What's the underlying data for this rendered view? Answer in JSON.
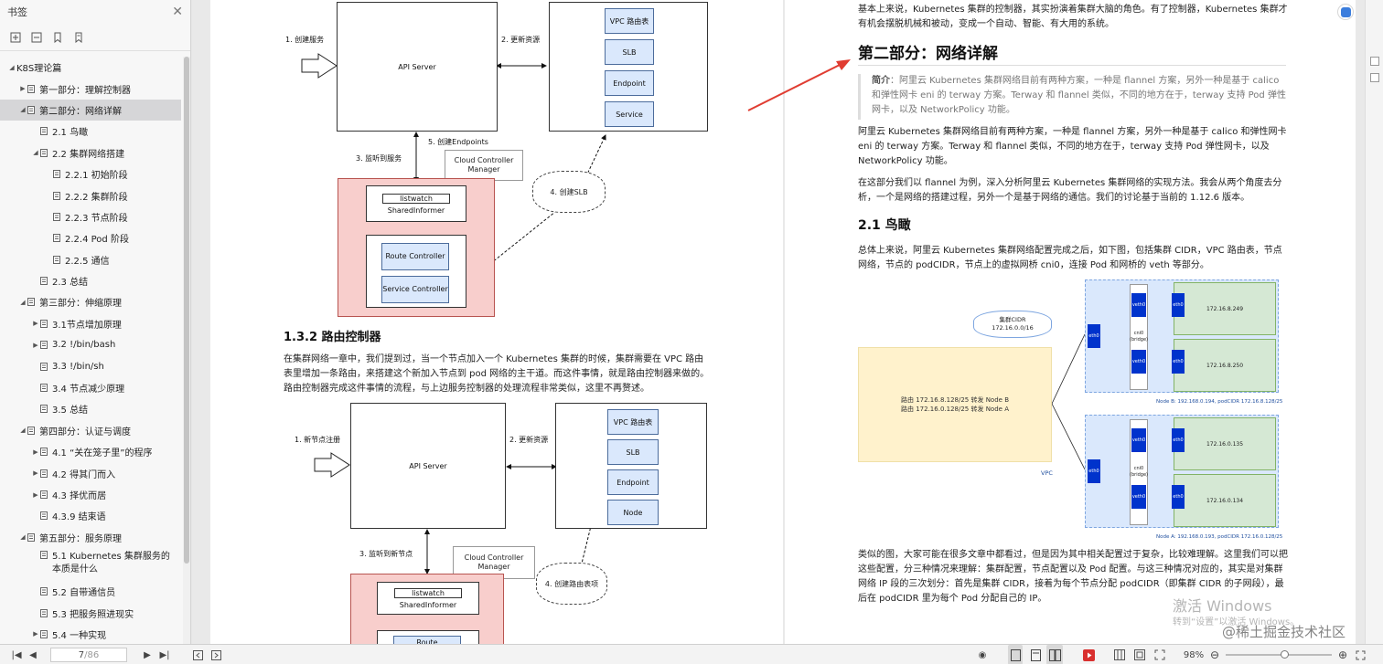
{
  "sidebar": {
    "title": "书签",
    "items": [
      {
        "label": "K8S理论篇",
        "level": 0,
        "expand": "▲",
        "bookmark": false
      },
      {
        "label": "第一部分：理解控制器",
        "level": 1,
        "expand": "▶",
        "bookmark": true
      },
      {
        "label": "第二部分：网络详解",
        "level": 1,
        "expand": "▲",
        "bookmark": true,
        "selected": true
      },
      {
        "label": "2.1 鸟瞰",
        "level": 2,
        "expand": "",
        "bookmark": true
      },
      {
        "label": "2.2 集群网络搭建",
        "level": 2,
        "expand": "▲",
        "bookmark": true
      },
      {
        "label": "2.2.1 初始阶段",
        "level": 3,
        "expand": "",
        "bookmark": true
      },
      {
        "label": "2.2.2 集群阶段",
        "level": 3,
        "expand": "",
        "bookmark": true
      },
      {
        "label": "2.2.3 节点阶段",
        "level": 3,
        "expand": "",
        "bookmark": true
      },
      {
        "label": "2.2.4 Pod 阶段",
        "level": 3,
        "expand": "",
        "bookmark": true
      },
      {
        "label": "2.2.5 通信",
        "level": 3,
        "expand": "",
        "bookmark": true
      },
      {
        "label": "2.3 总结",
        "level": 2,
        "expand": "",
        "bookmark": true
      },
      {
        "label": "第三部分：伸缩原理",
        "level": 1,
        "expand": "▲",
        "bookmark": true
      },
      {
        "label": "3.1节点增加原理",
        "level": 2,
        "expand": "▶",
        "bookmark": true
      },
      {
        "label": "3.2 !/bin/bash",
        "level": 2,
        "expand": "▶",
        "bookmark": true
      },
      {
        "label": "3.3 !/bin/sh",
        "level": 2,
        "expand": "",
        "bookmark": true
      },
      {
        "label": "3.4 节点减少原理",
        "level": 2,
        "expand": "",
        "bookmark": true
      },
      {
        "label": "3.5 总结",
        "level": 2,
        "expand": "",
        "bookmark": true
      },
      {
        "label": "第四部分：认证与调度",
        "level": 1,
        "expand": "▲",
        "bookmark": true
      },
      {
        "label": "4.1 “关在笼子里”的程序",
        "level": 2,
        "expand": "▶",
        "bookmark": true
      },
      {
        "label": "4.2 得其门而入",
        "level": 2,
        "expand": "▶",
        "bookmark": true
      },
      {
        "label": "4.3 择优而居",
        "level": 2,
        "expand": "▶",
        "bookmark": true
      },
      {
        "label": "4.3.9 结束语",
        "level": 2,
        "expand": "",
        "bookmark": true
      },
      {
        "label": "第五部分：服务原理",
        "level": 1,
        "expand": "▲",
        "bookmark": true
      },
      {
        "label": "5.1 Kubernetes 集群服务的本质是什么",
        "level": 2,
        "expand": "",
        "bookmark": true,
        "tall": true
      },
      {
        "label": "5.2 自带通信员",
        "level": 2,
        "expand": "",
        "bookmark": true
      },
      {
        "label": "5.3 把服务照进现实",
        "level": 2,
        "expand": "",
        "bookmark": true
      },
      {
        "label": "5.4 一种实现",
        "level": 2,
        "expand": "▶",
        "bookmark": true
      }
    ]
  },
  "left_page": {
    "diagram1": {
      "step1": "1. 创建服务",
      "api_server": "API Server",
      "step2": "2. 更新资源",
      "resources": [
        "VPC 路由表",
        "SLB",
        "Endpoint",
        "Service"
      ],
      "step3": "3. 监听到服务",
      "step5": "5. 创建Endpoints",
      "ccm": "Cloud Controller Manager",
      "step4": "4. 创建SLB",
      "listwatch": "listwatch",
      "informer": "SharedInformer",
      "ctrl1": "Route Controller",
      "ctrl2": "Service Controller"
    },
    "heading": "1.3.2 路由控制器",
    "paragraph": "在集群网络一章中，我们提到过，当一个节点加入一个 Kubernetes 集群的时候，集群需要在 VPC 路由表里增加一条路由，来搭建这个新加入节点到 pod 网络的主干道。而这件事情，就是路由控制器来做的。路由控制器完成这件事情的流程，与上边服务控制器的处理流程非常类似，这里不再赘述。",
    "diagram2": {
      "step1": "1. 新节点注册",
      "api_server": "API Server",
      "step2": "2. 更新资源",
      "resources": [
        "VPC 路由表",
        "SLB",
        "Endpoint",
        "Node"
      ],
      "step3": "3. 监听到新节点",
      "ccm": "Cloud Controller Manager",
      "step4": "4. 创建路由表项",
      "listwatch": "listwatch",
      "informer": "SharedInformer",
      "ctrl1": "Route"
    }
  },
  "right_page": {
    "intro": "基本上来说，Kubernetes 集群的控制器，其实扮演着集群大脑的角色。有了控制器，Kubernetes 集群才有机会摆脱机械和被动，变成一个自动、智能、有大用的系统。",
    "h2": "第二部分：网络详解",
    "quote_label": "简介",
    "quote": "：阿里云 Kubernetes 集群网络目前有两种方案，一种是 flannel 方案，另外一种是基于 calico 和弹性网卡 eni 的 terway 方案。Terway 和 flannel 类似，不同的地方在于，terway 支持 Pod 弹性网卡，以及 NetworkPolicy 功能。",
    "p1": "阿里云 Kubernetes 集群网络目前有两种方案，一种是 flannel 方案，另外一种是基于 calico 和弹性网卡 eni 的 terway 方案。Terway 和 flannel 类似，不同的地方在于，terway 支持 Pod 弹性网卡，以及 NetworkPolicy 功能。",
    "p2": "在这部分我们以 flannel 为例，深入分析阿里云 Kubernetes 集群网络的实现方法。我会从两个角度去分析，一个是网络的搭建过程，另外一个是基于网络的通信。我们的讨论基于当前的 1.12.6 版本。",
    "h3": "2.1 鸟瞰",
    "p3": "总体上来说，阿里云 Kubernetes 集群网络配置完成之后，如下图，包括集群 CIDR，VPC 路由表，节点网络，节点的 podCIDR，节点上的虚拟网桥 cni0，连接 Pod 和网桥的 veth 等部分。",
    "figure": {
      "cluster_cidr": "集群CIDR",
      "cluster_cidr_val": "172.16.0.0/16",
      "route1": "路由 172.16.8.128/25 转发 Node B",
      "route2": "路由 172.16.0.128/25 转发 Node A",
      "vpc": "VPC",
      "nodeB_label": "Node B: 192.168.0.194, podCIDR 172.16.8.128/25",
      "nodeA_label": "Node A: 192.168.0.193, podCIDR 172.16.0.128/25",
      "eth0": "eth0",
      "veth0": "veth0",
      "cni0": "cni0 (bridge)",
      "nodeB_pods": [
        "172.16.8.249",
        "172.16.8.250"
      ],
      "nodeA_pods": [
        "172.16.0.135",
        "172.16.0.134"
      ]
    },
    "p4": "类似的图，大家可能在很多文章中都看过，但是因为其中相关配置过于复杂，比较难理解。这里我们可以把这些配置，分三种情况来理解：集群配置，节点配置以及 Pod 配置。与这三种情况对应的，其实是对集群网络 IP 段的三次划分：首先是集群 CIDR，接着为每个节点分配 podCIDR（即集群 CIDR 的子网段），最后在 podCIDR 里为每个 Pod 分配自己的 IP。",
    "watermark1": "激活 Windows",
    "watermark2": "转到“设置”以激活 Windows。",
    "watermark3": "@稀土掘金技术社区"
  },
  "bottombar": {
    "current_page": "7",
    "total_pages": "/86",
    "zoom": "98%"
  },
  "colors": {
    "accent": "#dc3a34",
    "arrow": "#e03c31",
    "selected": "#d6d6d8"
  }
}
